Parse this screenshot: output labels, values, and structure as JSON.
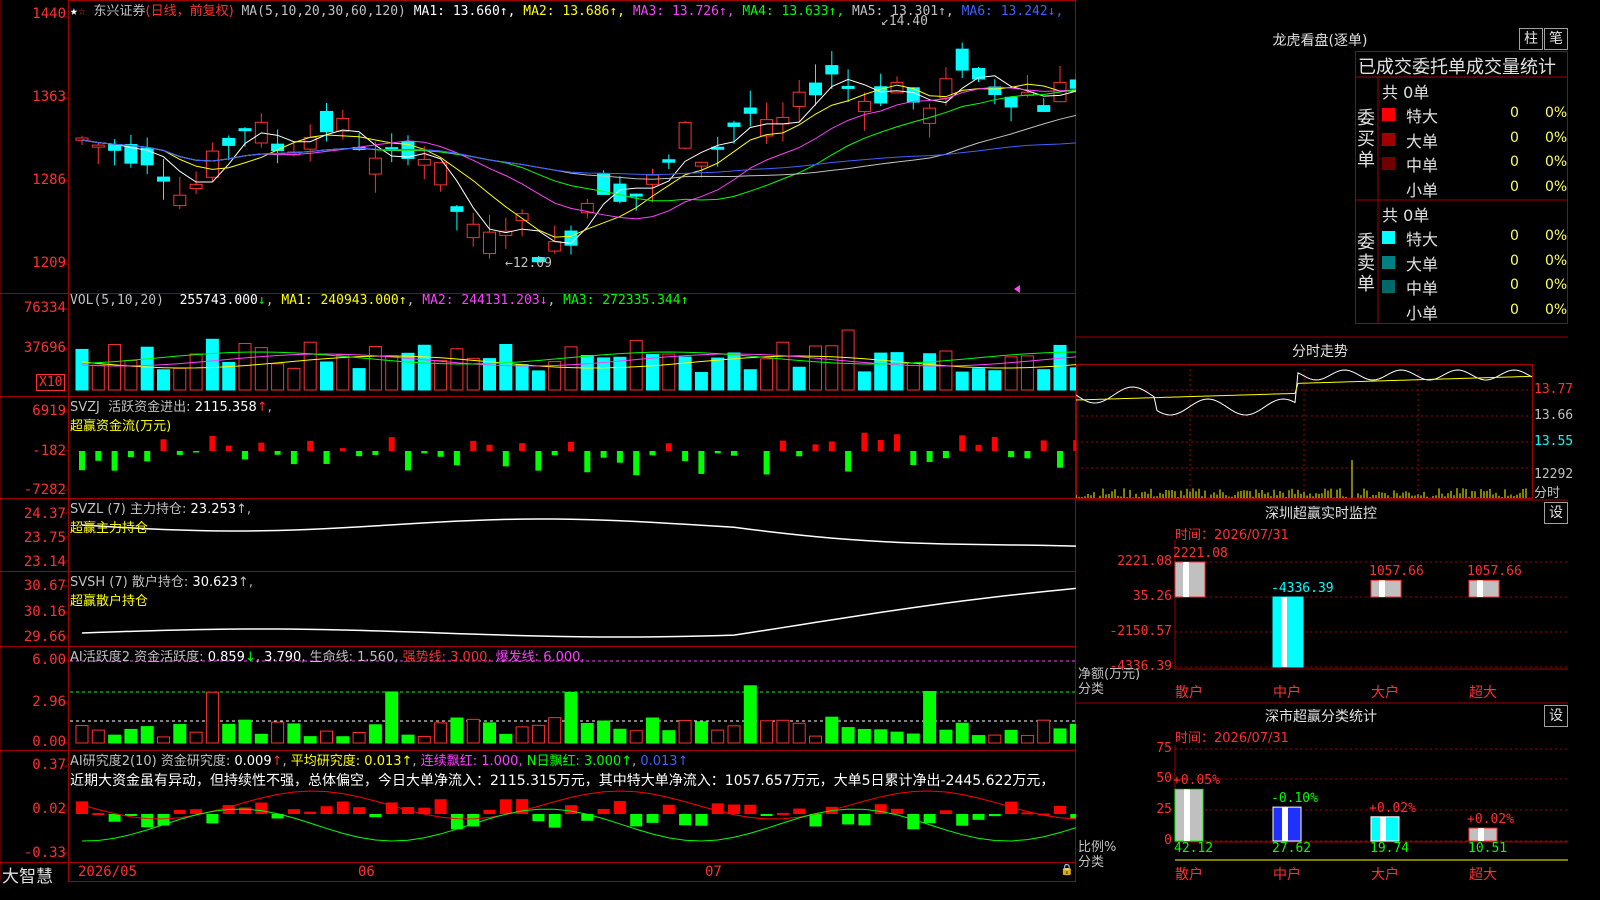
{
  "stock": {
    "name": "东兴证券",
    "period": "(日线，前复权)"
  },
  "colors": {
    "up": "#ff3030",
    "down": "#00ffff",
    "grid": "#a00000",
    "bg": "#000000"
  },
  "main": {
    "ma_label": "MA(5,10,20,30,60,120)",
    "ma": [
      {
        "name": "MA1",
        "value": "13.660",
        "arrow": "↑",
        "color": "#ffffff"
      },
      {
        "name": "MA2",
        "value": "13.686",
        "arrow": "↑",
        "color": "#ffff00"
      },
      {
        "name": "MA3",
        "value": "13.726",
        "arrow": "↑",
        "color": "#ff40ff"
      },
      {
        "name": "MA4",
        "value": "13.633",
        "arrow": "↑",
        "color": "#00ff00"
      },
      {
        "name": "MA5",
        "value": "13.301",
        "arrow": "↑",
        "color": "#c0c0c0"
      },
      {
        "name": "MA6",
        "value": "13.242",
        "arrow": "↓",
        "color": "#4060ff"
      }
    ],
    "yticks": [
      "1440",
      "1363",
      "1286",
      "1209"
    ],
    "high_mark": "14.40",
    "low_mark": "←12.09"
  },
  "vol": {
    "label": "VOL(5,10,20)",
    "value": "255743.000",
    "ma1": "240943.000",
    "ma2": "244131.203",
    "ma3": "272335.344",
    "yticks": [
      "76334",
      "37696"
    ],
    "unit": "X10"
  },
  "svzj": {
    "label": "SVZJ",
    "title": "活跃资金进出",
    "value": "2115.358",
    "sub": "超赢资金流(万元)",
    "yticks": [
      "6919",
      "-182",
      "-7282"
    ]
  },
  "svzl": {
    "label": "SVZL  (7)",
    "title": "主力持仓",
    "value": "23.253",
    "sub": "超赢主力持仓",
    "yticks": [
      "24.37",
      "23.75",
      "23.14"
    ]
  },
  "svsh": {
    "label": "SVSH  (7)",
    "title": "散户持仓",
    "value": "30.623",
    "sub": "超赢散户持仓",
    "yticks": [
      "30.67",
      "30.16",
      "29.66"
    ]
  },
  "ai1": {
    "label": "AI活跃度2",
    "t1": "资金活跃度",
    "v1": "0.859",
    "v2": "3.790",
    "t3": "生命线",
    "v3": "1.560",
    "t4": "强势线",
    "v4": "3.000",
    "t5": "爆发线",
    "v5": "6.000",
    "yticks": [
      "6.00",
      "2.96",
      "0.00"
    ]
  },
  "ai2": {
    "label": "AI研究度2(10)",
    "t1": "资金研究度",
    "v1": "0.009",
    "t2": "平均研究度",
    "v2": "0.013",
    "t3": "连续飘红",
    "v3": "1.000",
    "t4": "N日飘红",
    "v4": "3.000",
    "v5": "0.013",
    "note": "近期大资金虽有异动，但持续性不强，总体偏空，今日大单净流入：2115.315万元，其中特大单净流入：1057.657万元，大单5日累计净出-2445.622万元，",
    "yticks": [
      "0.37",
      "0.02",
      "-0.33"
    ]
  },
  "xaxis": {
    "labels": [
      "2026/05",
      "06",
      "07"
    ],
    "brand": "大智慧"
  },
  "longhu": {
    "title": "龙虎看盘(逐单)",
    "btn_a": "柱",
    "btn_b": "笔",
    "header": "已成交委托单成交量统计",
    "buy_label": "委买单",
    "sell_label": "委卖单",
    "buy_total": "共 0单",
    "sell_total": "共 0单",
    "buy_rows": [
      {
        "name": "特大",
        "count": "0",
        "pct": "0%",
        "color": "#ff0000"
      },
      {
        "name": "大单",
        "count": "0",
        "pct": "0%",
        "color": "#a00000"
      },
      {
        "name": "中单",
        "count": "0",
        "pct": "0%",
        "color": "#700000"
      },
      {
        "name": "小单",
        "count": "0",
        "pct": "0%",
        "color": ""
      }
    ],
    "sell_rows": [
      {
        "name": "特大",
        "count": "0",
        "pct": "0%",
        "color": "#00ffff"
      },
      {
        "name": "大单",
        "count": "0",
        "pct": "0%",
        "color": "#008080"
      },
      {
        "name": "中单",
        "count": "0",
        "pct": "0%",
        "color": "#006868"
      },
      {
        "name": "小单",
        "count": "0",
        "pct": "0%",
        "color": ""
      }
    ]
  },
  "intraday": {
    "title": "分时走势",
    "yticks": [
      "13.77",
      "13.66",
      "13.55"
    ],
    "vol_tick": "12292",
    "vol_unit": "分时"
  },
  "sz_monitor": {
    "title": "深圳超赢实时监控",
    "btn": "设",
    "time": "时间：2026/07/31",
    "yticks": [
      "2221.08",
      "35.26",
      "-2150.57",
      "-4336.39"
    ],
    "axis_label_1": "净额(万元)",
    "axis_label_2": "分类",
    "bars": [
      {
        "cat": "散户",
        "value": "2221.08"
      },
      {
        "cat": "中户",
        "value": "-4336.39"
      },
      {
        "cat": "大户",
        "value": "1057.66"
      },
      {
        "cat": "超大",
        "value": "1057.66"
      }
    ]
  },
  "sz_class": {
    "title": "深市超赢分类统计",
    "btn": "设",
    "time": "时间：2026/07/31",
    "yticks": [
      "75",
      "50",
      "25",
      "0"
    ],
    "axis_label_1": "比例%",
    "axis_label_2": "分类",
    "bars": [
      {
        "cat": "散户",
        "value": "42.12",
        "chg": "+0.05%"
      },
      {
        "cat": "中户",
        "value": "27.62",
        "chg": "-0.10%"
      },
      {
        "cat": "大户",
        "value": "19.74",
        "chg": "+0.02%"
      },
      {
        "cat": "超大",
        "value": "10.51",
        "chg": "+0.02%"
      }
    ]
  }
}
